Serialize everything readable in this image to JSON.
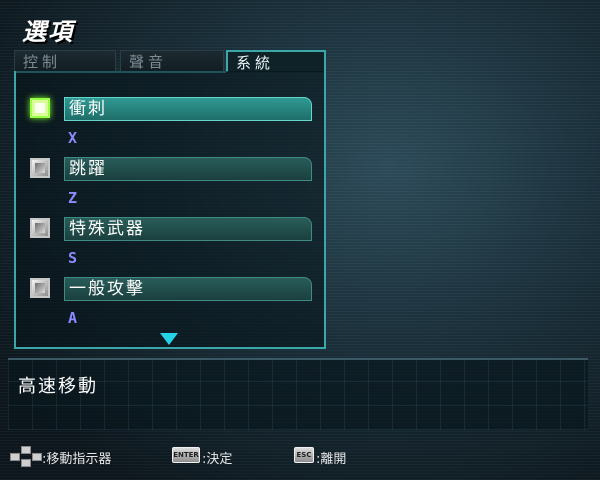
{
  "title": "選項",
  "tabs": [
    {
      "label": "控制",
      "active": false
    },
    {
      "label": "聲音",
      "active": false
    },
    {
      "label": "系統",
      "active": true
    }
  ],
  "options": [
    {
      "label": "衝刺",
      "key": "X",
      "selected": true
    },
    {
      "label": "跳躍",
      "key": "Z",
      "selected": false
    },
    {
      "label": "特殊武器",
      "key": "S",
      "selected": false
    },
    {
      "label": "一般攻擊",
      "key": "A",
      "selected": false
    }
  ],
  "description": "高速移動",
  "footer": {
    "move_label": ":移動指示器",
    "enter_key": "ENTER",
    "enter_label": ":決定",
    "esc_key": "ESC",
    "esc_label": ":離開"
  },
  "colors": {
    "accent": "#3ba7a8",
    "key_text": "#8b8bff",
    "selected_glow": "#9cff45",
    "scroll_arrow": "#24d4e6"
  }
}
